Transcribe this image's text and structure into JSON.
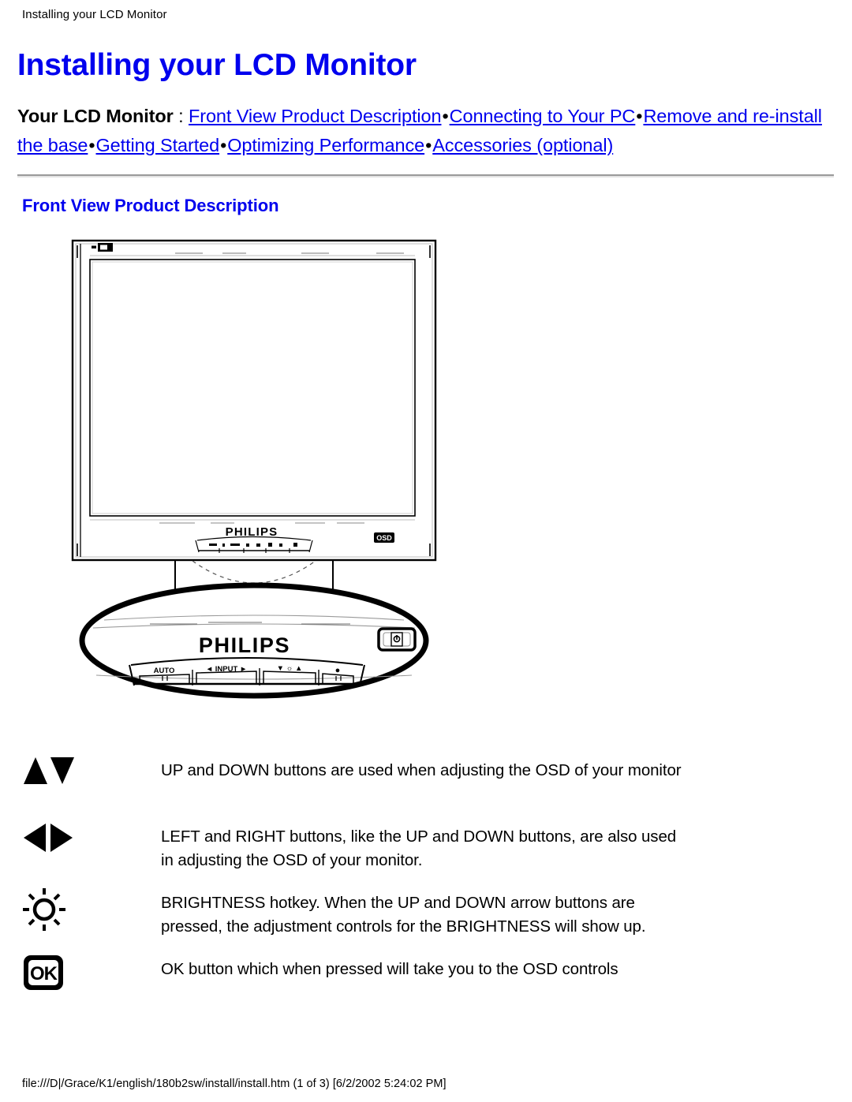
{
  "page": {
    "header_text": "Installing your LCD Monitor",
    "title": "Installing your LCD Monitor",
    "footer_text": "file:///D|/Grace/K1/english/180b2sw/install/install.htm (1 of 3) [6/2/2002 5:24:02 PM]",
    "link_color": "#0000EE",
    "text_color": "#000000",
    "rule_color": "#9A9A9A",
    "background": "#FFFFFF"
  },
  "nav": {
    "label": "Your LCD Monitor",
    "colon": " : ",
    "separator": "•",
    "links": [
      {
        "label": "Front View Product Description"
      },
      {
        "label": "Connecting to Your PC"
      },
      {
        "label": "Remove and re-install the base"
      },
      {
        "label": "Getting Started"
      },
      {
        "label": "Optimizing Performance"
      },
      {
        "label": "Accessories (optional)"
      }
    ]
  },
  "section": {
    "title": "Front View Product Description"
  },
  "figure": {
    "alt": "Philips LCD monitor front view with oval base",
    "brand": "PHILIPS",
    "bezel_brand": "PHILIPS",
    "bezel_badge": "OSD",
    "top_left_badge": "label",
    "base_controls": [
      {
        "label": "AUTO"
      },
      {
        "label": "◄ INPUT ►"
      },
      {
        "label": "▼ ☼ ▲"
      },
      {
        "label": "●"
      }
    ],
    "power_button": "power"
  },
  "legend": {
    "rows": [
      {
        "icon": "up-down-arrows-icon",
        "line1": "UP and DOWN buttons are used when adjusting the OSD of your monitor",
        "line2": ""
      },
      {
        "icon": "left-right-arrows-icon",
        "line1": "LEFT and RIGHT buttons, like the UP and DOWN buttons, are also used",
        "line2": "in adjusting the OSD of your monitor."
      },
      {
        "icon": "brightness-icon",
        "line1": "BRIGHTNESS hotkey. When the UP and DOWN arrow buttons are",
        "line2": "pressed, the adjustment controls for the BRIGHTNESS will show up."
      },
      {
        "icon": "ok-button-icon",
        "line1": "OK button which when pressed will take you to the OSD controls",
        "line2": ""
      }
    ]
  }
}
